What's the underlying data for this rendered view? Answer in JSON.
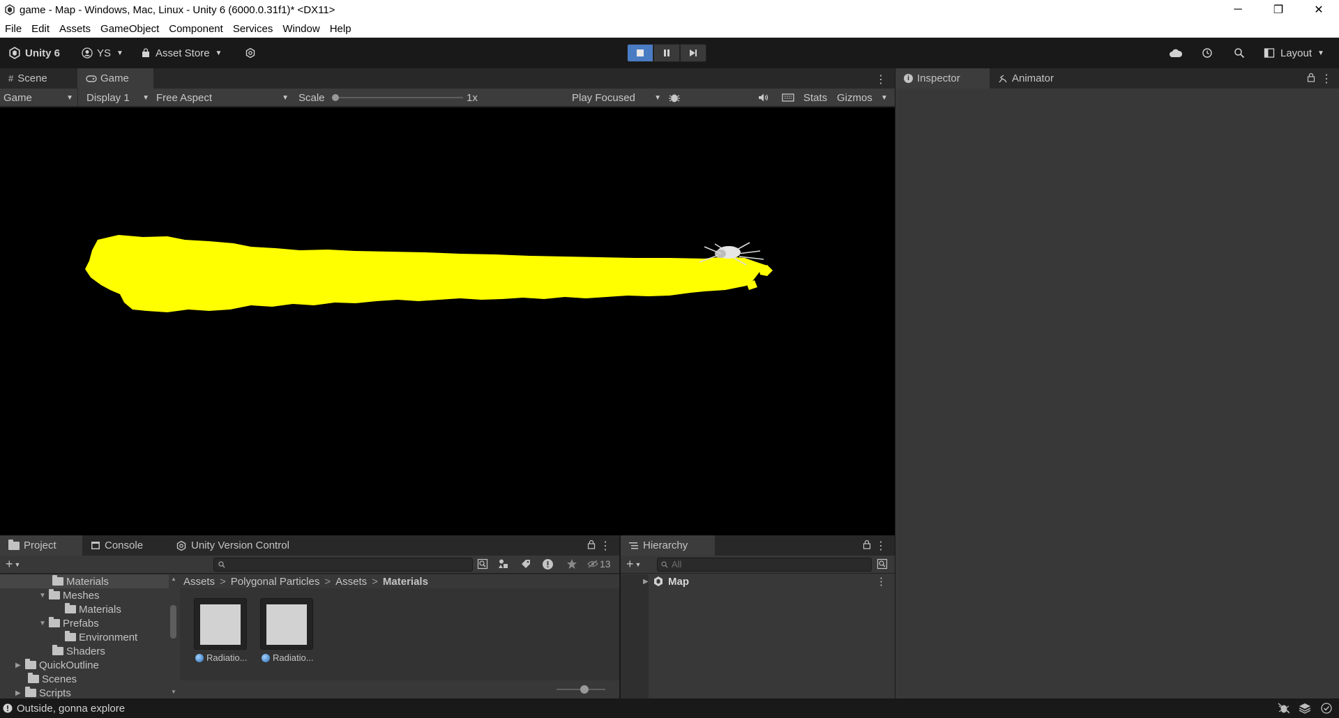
{
  "window": {
    "title": "game - Map - Windows, Mac, Linux - Unity 6 (6000.0.31f1)* <DX11>",
    "controls": [
      "─",
      "❐",
      "✕"
    ]
  },
  "menu": [
    "File",
    "Edit",
    "Assets",
    "GameObject",
    "Component",
    "Services",
    "Window",
    "Help"
  ],
  "toolbar": {
    "unity_label": "Unity 6",
    "account_label": "YS",
    "asset_store_label": "Asset Store",
    "layout_label": "Layout"
  },
  "game_panel": {
    "tabs": [
      "Scene",
      "Game"
    ],
    "active_tab": "Game",
    "game_dropdown": "Game",
    "display_dropdown": "Display 1",
    "aspect_dropdown": "Free Aspect",
    "scale_label": "Scale",
    "scale_value": "1x",
    "scale_slider_fraction": 0.0,
    "play_mode_dropdown": "Play Focused",
    "stats_label": "Stats",
    "gizmos_label": "Gizmos",
    "colors": {
      "game_background": "#000000",
      "yellow_terrain": "#ffff00"
    }
  },
  "inspector_panel": {
    "tabs": [
      "Inspector",
      "Animator"
    ],
    "active_tab": "Inspector"
  },
  "project_panel": {
    "tabs": [
      "Project",
      "Console",
      "Unity Version Control"
    ],
    "active_tab": "Project",
    "hidden_count": "13",
    "tree": [
      {
        "label": "Materials",
        "depth": 3,
        "expanded": null,
        "selected": true
      },
      {
        "label": "Meshes",
        "depth": 2,
        "expanded": true
      },
      {
        "label": "Materials",
        "depth": 3,
        "expanded": null
      },
      {
        "label": "Prefabs",
        "depth": 2,
        "expanded": true
      },
      {
        "label": "Environment",
        "depth": 3,
        "expanded": null
      },
      {
        "label": "Shaders",
        "depth": 2,
        "expanded": null
      },
      {
        "label": "QuickOutline",
        "depth": 1,
        "expanded": false
      },
      {
        "label": "Scenes",
        "depth": 1,
        "expanded": null
      },
      {
        "label": "Scripts",
        "depth": 1,
        "expanded": false
      }
    ],
    "breadcrumb": [
      "Assets",
      "Polygonal Particles",
      "Assets",
      "Materials"
    ],
    "assets": [
      {
        "label": "Radiatio..."
      },
      {
        "label": "Radiatio..."
      }
    ]
  },
  "hierarchy_panel": {
    "tab": "Hierarchy",
    "search_placeholder": "All",
    "items": [
      {
        "label": "Map"
      }
    ]
  },
  "status_bar": {
    "message": "Outside, gonna explore"
  }
}
